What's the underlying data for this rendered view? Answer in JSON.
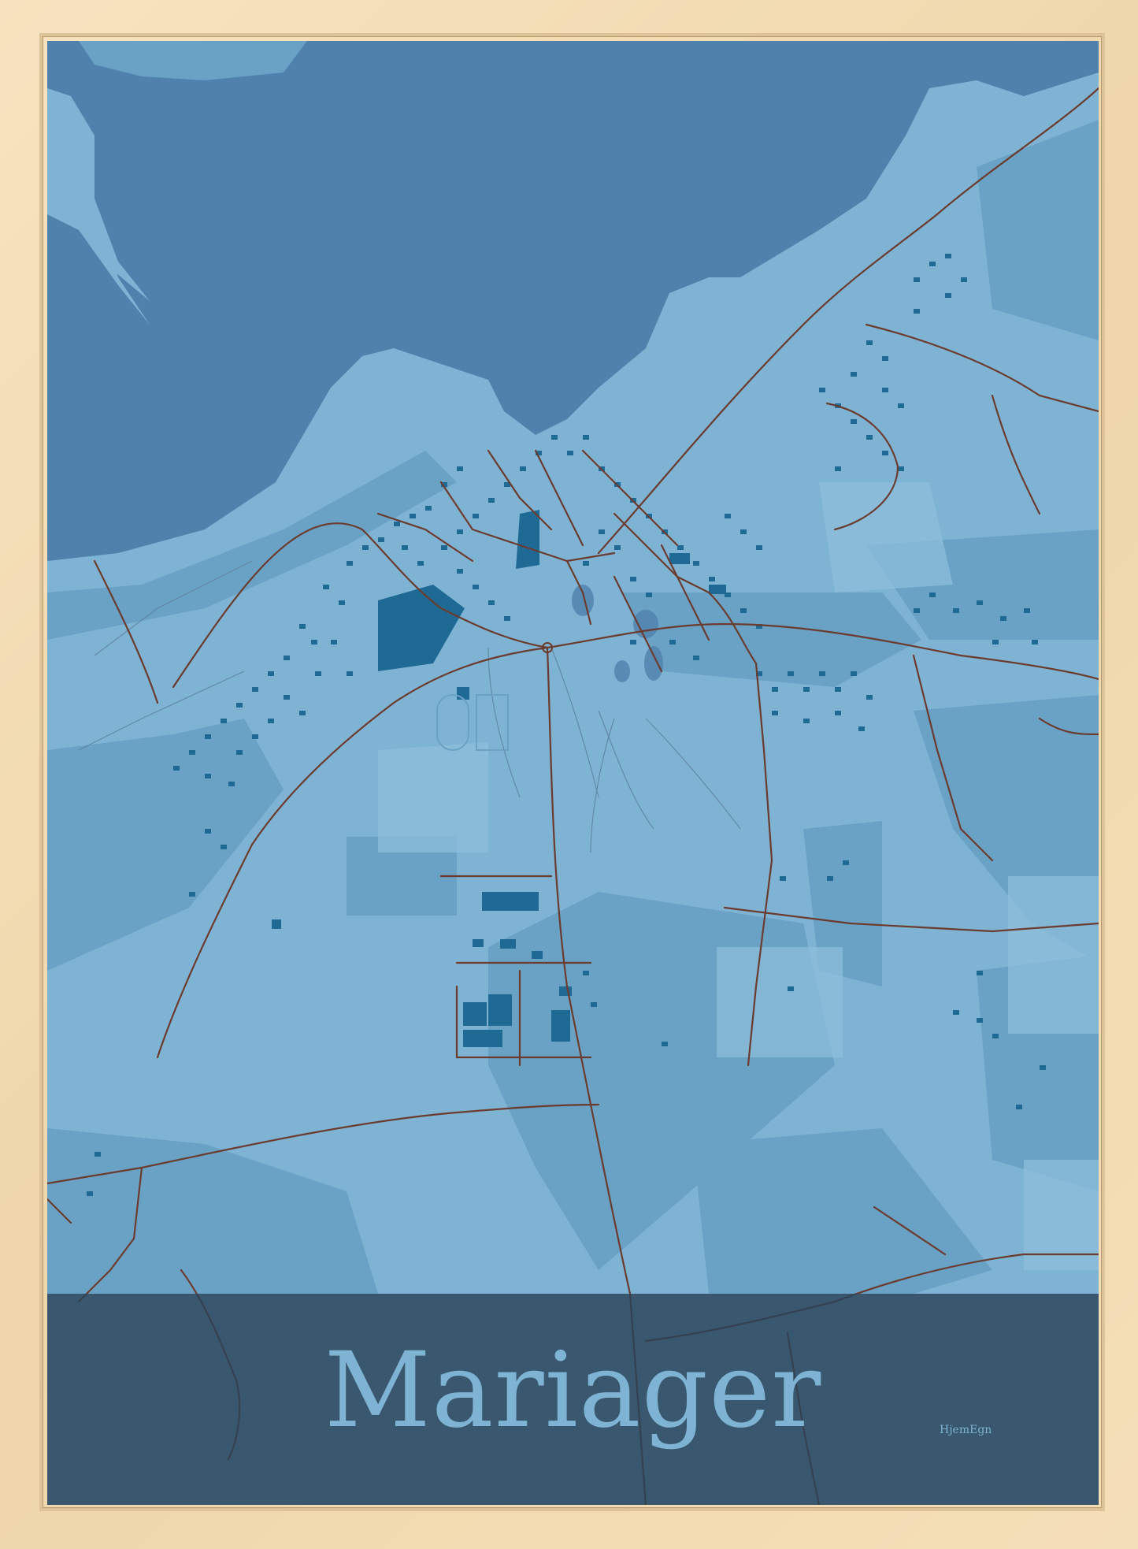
{
  "poster": {
    "title": "Mariager",
    "signature": "HjemEgn"
  },
  "colors": {
    "frame": "#f2dcb4",
    "water": "#4f81ac",
    "land": "#7fb3d3",
    "land_dark": "#6aa2c6",
    "buildings": "#1f6a95",
    "roads": "#6b3b2e",
    "title_band": "#2a4358",
    "title_text": "#7fb3d3"
  },
  "icons": {
    "frame": "wooden-frame",
    "map": "street-map"
  }
}
